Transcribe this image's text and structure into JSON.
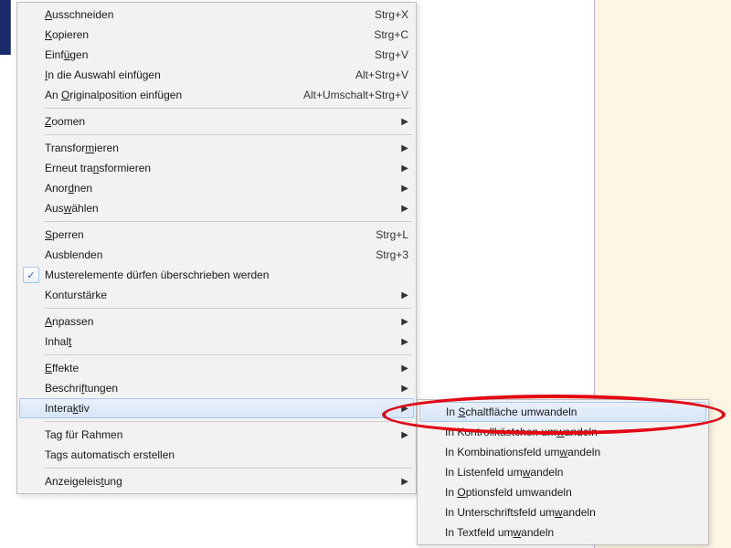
{
  "menu": {
    "items": [
      {
        "label_pre": "",
        "key": "A",
        "label_post": "usschneiden",
        "shortcut": "Strg+X"
      },
      {
        "label_pre": "",
        "key": "K",
        "label_post": "opieren",
        "shortcut": "Strg+C"
      },
      {
        "label_pre": "Einf",
        "key": "ü",
        "label_post": "gen",
        "shortcut": "Strg+V"
      },
      {
        "label_pre": "",
        "key": "I",
        "label_post": "n die Auswahl einfügen",
        "shortcut": "Alt+Strg+V"
      },
      {
        "label_pre": "An ",
        "key": "O",
        "label_post": "riginalposition einfügen",
        "shortcut": "Alt+Umschalt+Strg+V"
      },
      {
        "sep": true
      },
      {
        "label_pre": "",
        "key": "Z",
        "label_post": "oomen",
        "submenu": true
      },
      {
        "sep": true
      },
      {
        "label_pre": "Transfor",
        "key": "m",
        "label_post": "ieren",
        "submenu": true
      },
      {
        "label_pre": "Erneut tra",
        "key": "n",
        "label_post": "sformieren",
        "submenu": true
      },
      {
        "label_pre": "Anor",
        "key": "d",
        "label_post": "nen",
        "submenu": true
      },
      {
        "label_pre": "Aus",
        "key": "w",
        "label_post": "ählen",
        "submenu": true
      },
      {
        "sep": true
      },
      {
        "label_pre": "",
        "key": "S",
        "label_post": "perren",
        "shortcut": "Strg+L"
      },
      {
        "label_pre": "Ausblenden",
        "key": "",
        "label_post": "",
        "shortcut": "Strg+3"
      },
      {
        "label_pre": "Musterelemente dürfen überschrieben werden",
        "key": "",
        "label_post": "",
        "checked": true
      },
      {
        "label_pre": "Konturstärke",
        "key": "",
        "label_post": "",
        "submenu": true
      },
      {
        "sep": true
      },
      {
        "label_pre": "",
        "key": "A",
        "label_post": "npassen",
        "submenu": true
      },
      {
        "label_pre": "Inhal",
        "key": "t",
        "label_post": "",
        "submenu": true
      },
      {
        "sep": true
      },
      {
        "label_pre": "",
        "key": "E",
        "label_post": "ffekte",
        "submenu": true
      },
      {
        "label_pre": "Beschri",
        "key": "f",
        "label_post": "tungen",
        "submenu": true
      },
      {
        "label_pre": "Intera",
        "key": "k",
        "label_post": "tiv",
        "submenu": true,
        "highlighted": true
      },
      {
        "sep": true
      },
      {
        "label_pre": "Tag für Rahmen",
        "key": "",
        "label_post": "",
        "submenu": true
      },
      {
        "label_pre": "Tags automatisch erstellen",
        "key": "",
        "label_post": ""
      },
      {
        "sep": true
      },
      {
        "label_pre": "Anzeigeleis",
        "key": "t",
        "label_post": "ung",
        "submenu": true
      }
    ]
  },
  "submenu": {
    "items": [
      {
        "label_pre": "In ",
        "key": "S",
        "label_post": "chaltfläche umwandeln",
        "highlighted": true
      },
      {
        "label_pre": "In Kontrollkästchen um",
        "key": "w",
        "label_post": "andeln"
      },
      {
        "label_pre": "In Kombinationsfeld um",
        "key": "w",
        "label_post": "andeln"
      },
      {
        "label_pre": "In Listenfeld um",
        "key": "w",
        "label_post": "andeln"
      },
      {
        "label_pre": "In ",
        "key": "O",
        "label_post": "ptionsfeld umwandeln"
      },
      {
        "label_pre": "In Unterschriftsfeld um",
        "key": "w",
        "label_post": "andeln"
      },
      {
        "label_pre": "In Textfeld um",
        "key": "w",
        "label_post": "andeln"
      }
    ]
  }
}
